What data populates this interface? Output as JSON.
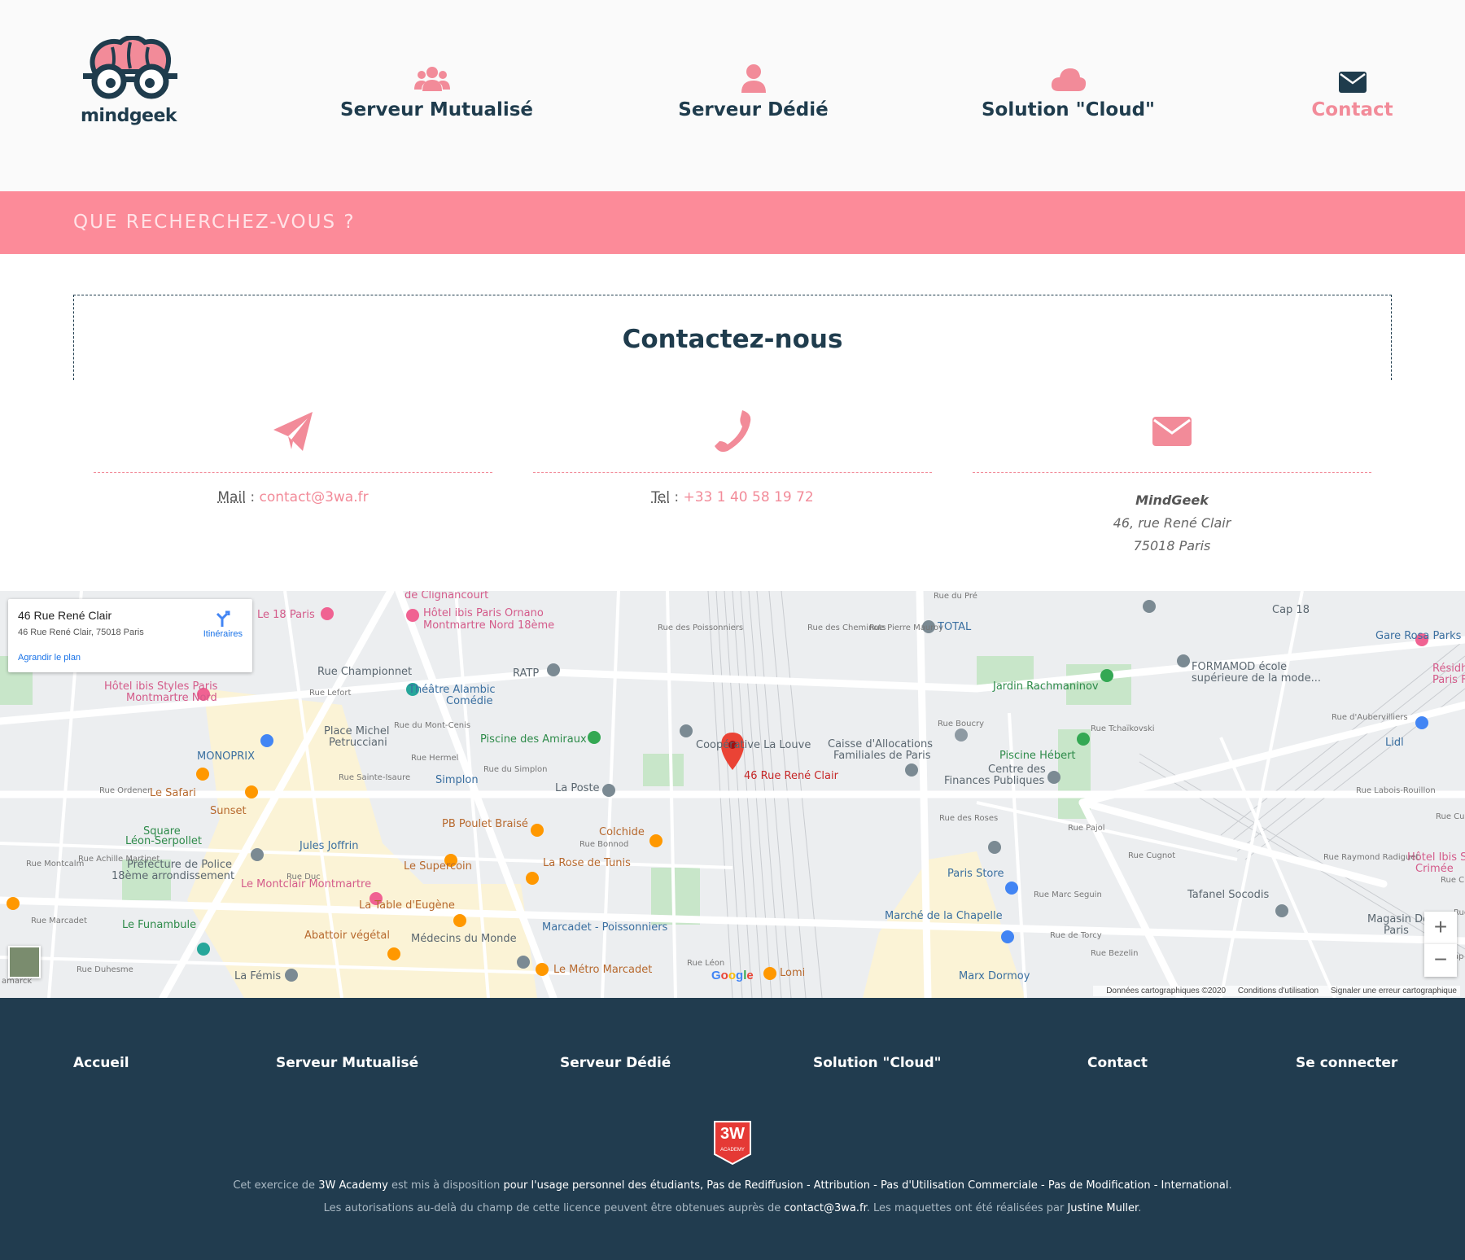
{
  "header": {
    "logo_text": "mindgeek",
    "nav": [
      {
        "label": "Serveur Mutualisé",
        "icon": "users-icon"
      },
      {
        "label": "Serveur Dédié",
        "icon": "user-icon"
      },
      {
        "label": "Solution \"Cloud\"",
        "icon": "cloud-icon"
      },
      {
        "label": "Contact",
        "icon": "envelope-icon",
        "active": true
      }
    ]
  },
  "search": {
    "placeholder": "QUE RECHERCHEZ-VOUS ?"
  },
  "contact": {
    "title": "Contactez-nous",
    "mail": {
      "label": "Mail",
      "sep": " : ",
      "value": "contact@3wa.fr"
    },
    "tel": {
      "label": "Tel",
      "sep": " : ",
      "value": "+33 1 40 58 19 72"
    },
    "address": {
      "company": "MindGeek",
      "street": "46, rue René Clair",
      "city": "75018 Paris"
    }
  },
  "map": {
    "place_title": "46 Rue René Clair",
    "place_address": "46 Rue René Clair, 75018 Paris",
    "directions": "Itinéraires",
    "enlarge": "Agrandir le plan",
    "marker_label": "46 Rue René Clair",
    "zoom_in": "+",
    "zoom_out": "−",
    "google": "Google",
    "footer": {
      "data": "Données cartographiques ©2020",
      "terms": "Conditions d'utilisation",
      "report": "Signaler une erreur cartographique"
    },
    "labels": [
      "de Clignancourt",
      "Le 18 Paris",
      "Hôtel ibis Paris Ornano",
      "Montmartre Nord 18ème",
      "Rue du Pré",
      "TOTAL",
      "Cap 18",
      "Gare Rosa Parks",
      "Rue Championnet",
      "RATP",
      "Hôtel ibis Styles Paris",
      "Montmartre Nord",
      "Théâtre Alambic",
      "Comédie",
      "FORMAMOD école",
      "supérieure de la mode...",
      "Jardin Rachmaninov",
      "Résidh",
      "Paris Fa",
      "Place Michel",
      "Petrucciani",
      "Piscine des Amiraux",
      "Coopérative La Louve",
      "Caisse d'Allocations",
      "Familiales de Paris",
      "Piscine Hébert",
      "Lidl",
      "MONOPRIX",
      "Centre des",
      "Finances Publiques",
      "Simplon",
      "La Poste",
      "Le Safari",
      "Sunset",
      "PB Poulet Braisé",
      "Colchide",
      "Square",
      "Léon-Serpollet",
      "Jules Joffrin",
      "Préfecture de Police",
      "18ème arrondissement",
      "Le Supercoin",
      "La Rose de Tunis",
      "Paris Store",
      "Le Montclair Montmartre",
      "Tafanel Socodis",
      "Hôtel Ibis S",
      "Crimée",
      "La Table d'Eugène",
      "Le Funambule",
      "Abattoir végétal",
      "Médecins du Monde",
      "Marcadet - Poissonniers",
      "Marché de la Chapelle",
      "Magasin Dé",
      "Paris",
      "La Fémis",
      "Le Métro Marcadet",
      "Lomi",
      "Marx Dormoy",
      "Rue Ordener",
      "Rue Marcadet",
      "Rue Duc",
      "Rue Hermel",
      "Rue des Poissonniers",
      "Rue Pierre Mauroy",
      "Rue des Cheminots",
      "Rue Boucry",
      "Rue des Roses",
      "Rue Pajol",
      "Rue Marc Seguin",
      "Rue de Torcy",
      "Rue Tchaïkovski",
      "Rue d'Aubervilliers",
      "Rue Labois-Rouillon",
      "Rue Raymond Radiguet",
      "Rue Curial",
      "Rue Cugnot",
      "Rue Bonnod",
      "Rue du Simplon",
      "Rue Lefort",
      "Rue du Mont-Cenis",
      "Rue Sainte-Isaure",
      "Rue Montcalm",
      "Rue Achille Martinet",
      "Rue Duhesme",
      "Rue Bezelin",
      "Rue Léon",
      "Rue Custine",
      "amarck",
      "Rue",
      "ap"
    ]
  },
  "footer": {
    "nav": [
      "Accueil",
      "Serveur Mutualisé",
      "Serveur Dédié",
      "Solution \"Cloud\"",
      "Contact",
      "Se connecter"
    ],
    "badge_title": "3W",
    "badge_sub": "ACADEMY",
    "line1": {
      "a": "Cet exercice de ",
      "b": "3W Academy",
      "c": " est mis à disposition ",
      "d": "pour l'usage personnel des étudiants, Pas de Rediffusion - Attribution - Pas d'Utilisation Commerciale - Pas de Modification - International",
      "e": "."
    },
    "line2": {
      "a": "Les autorisations au-delà du champ de cette licence peuvent être obtenues auprès de ",
      "b": "contact@3wa.fr",
      "c": ". Les maquettes ont été réalisées par ",
      "d": "Justine Muller",
      "e": "."
    }
  },
  "colors": {
    "primary": "#1f3c4d",
    "accent": "#f28b99",
    "search_bg": "#fc8b99",
    "footer_bg": "#213c4f"
  }
}
